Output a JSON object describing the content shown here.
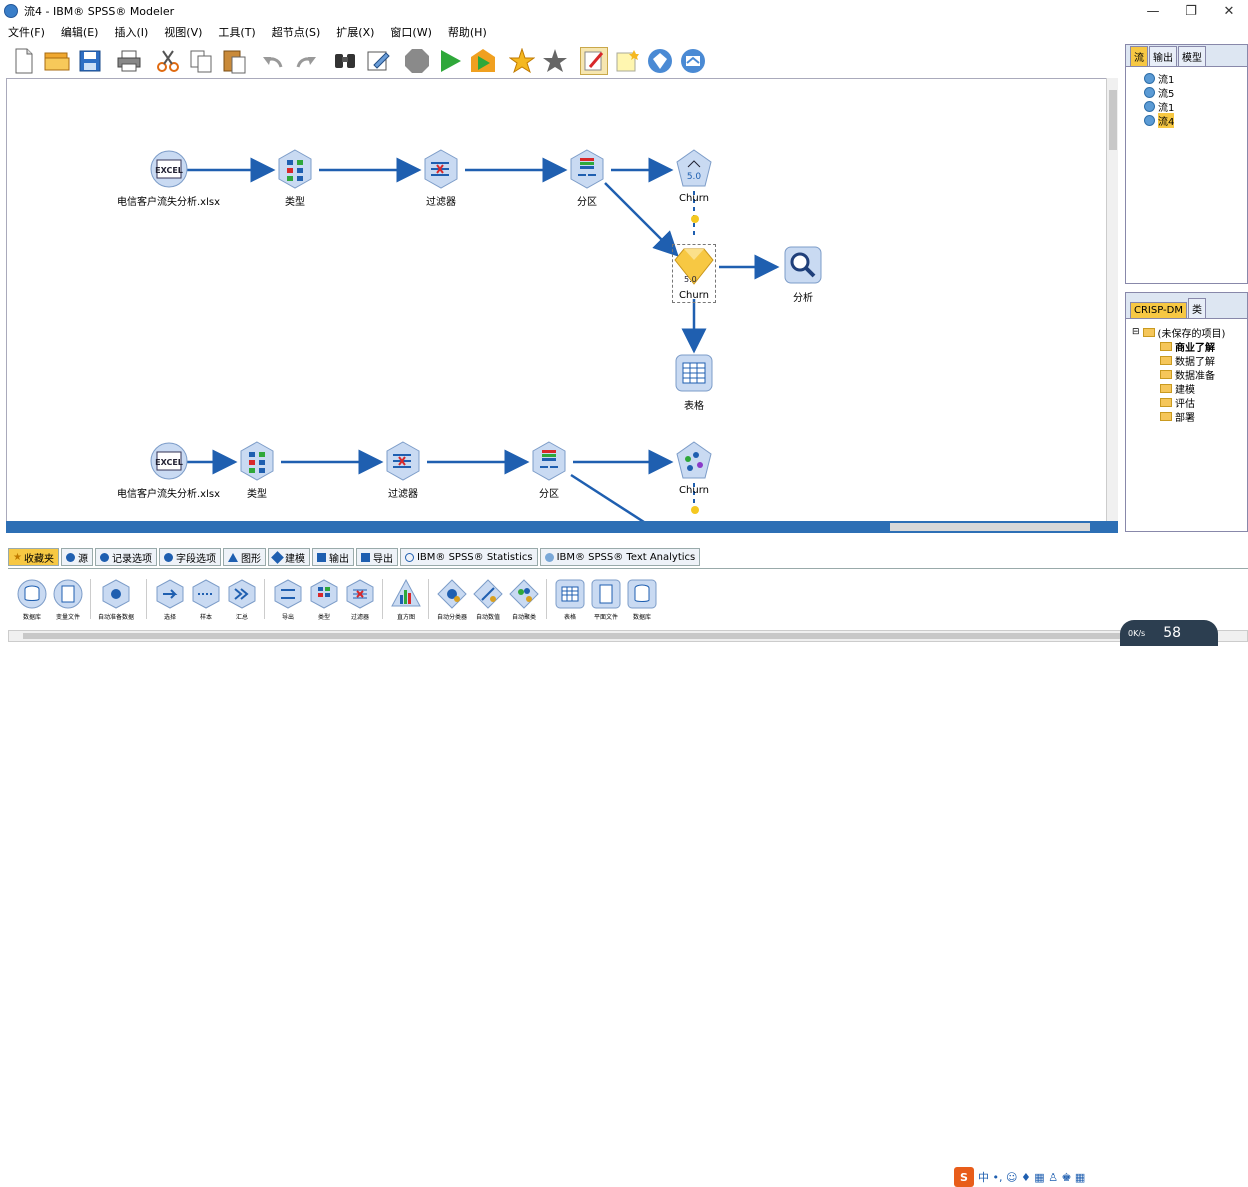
{
  "window": {
    "title": "流4 - IBM® SPSS® Modeler",
    "controls": [
      "—",
      "❐",
      "✕"
    ]
  },
  "menu": [
    "文件(F)",
    "编辑(E)",
    "插入(I)",
    "视图(V)",
    "工具(T)",
    "超节点(S)",
    "扩展(X)",
    "窗口(W)",
    "帮助(H)"
  ],
  "toolbar": {
    "icons": [
      "new-stream-icon",
      "open-icon",
      "save-icon",
      "print-icon",
      "cut-icon",
      "copy-icon",
      "paste-icon",
      "undo-icon",
      "redo-icon",
      "find-icon",
      "edit-icon",
      "stop-icon",
      "run-icon",
      "run-selection-icon",
      "add-to-favorites-icon",
      "favorites-icon",
      "annotation-icon",
      "new-comment-icon",
      "diamond-icon",
      "model-icon"
    ]
  },
  "canvas": {
    "stream1": {
      "source_label": "电信客户流失分析.xlsx",
      "type_label": "类型",
      "filter_label": "过滤器",
      "partition_label": "分区",
      "model_label": "Churn",
      "nugget_label": "Churn",
      "analysis_label": "分析",
      "table_label": "表格"
    },
    "stream2": {
      "source_label": "电信客户流失分析.xlsx",
      "type_label": "类型",
      "filter_label": "过滤器",
      "partition_label": "分区",
      "model_label": "Churn"
    }
  },
  "right_top": {
    "tabs": [
      "流",
      "输出",
      "模型"
    ],
    "active_tab": "流",
    "streams": [
      "流1",
      "流5",
      "流1",
      "流4"
    ],
    "selected_stream": "流4"
  },
  "right_bottom": {
    "tabs": [
      "CRISP-DM",
      "类"
    ],
    "active_tab": "CRISP-DM",
    "project": "(未保存的项目)",
    "phases": [
      "商业了解",
      "数据了解",
      "数据准备",
      "建模",
      "评估",
      "部署"
    ],
    "bold_phase": "商业了解"
  },
  "palette_tabs": [
    {
      "label": "收藏夹",
      "icon": "star"
    },
    {
      "label": "源",
      "icon": "circle"
    },
    {
      "label": "记录选项",
      "icon": "circle"
    },
    {
      "label": "字段选项",
      "icon": "circle"
    },
    {
      "label": "图形",
      "icon": "triangle"
    },
    {
      "label": "建模",
      "icon": "circle"
    },
    {
      "label": "输出",
      "icon": "square"
    },
    {
      "label": "导出",
      "icon": "square"
    },
    {
      "label": "IBM® SPSS® Statistics",
      "icon": "circle"
    },
    {
      "label": "IBM® SPSS® Text Analytics",
      "icon": "circle"
    }
  ],
  "palette_active": "收藏夹",
  "palette_nodes": [
    "数据库",
    "变量文件",
    "自动准备数据",
    "选择",
    "样本",
    "汇总",
    "导出",
    "类型",
    "过滤器",
    "直方图",
    "自动分类器",
    "自动数值",
    "自动聚类",
    "表格",
    "平面文件",
    "数据库"
  ],
  "ime": {
    "text": "中 •, ☺ ♦ ▦ ♙ ♚ ▦"
  },
  "speed": {
    "small": "0K/s",
    "big": "58"
  },
  "colors": {
    "accent": "#1f5fb0",
    "active_tab": "#f7c843",
    "node_fill": "#c9daf2"
  }
}
